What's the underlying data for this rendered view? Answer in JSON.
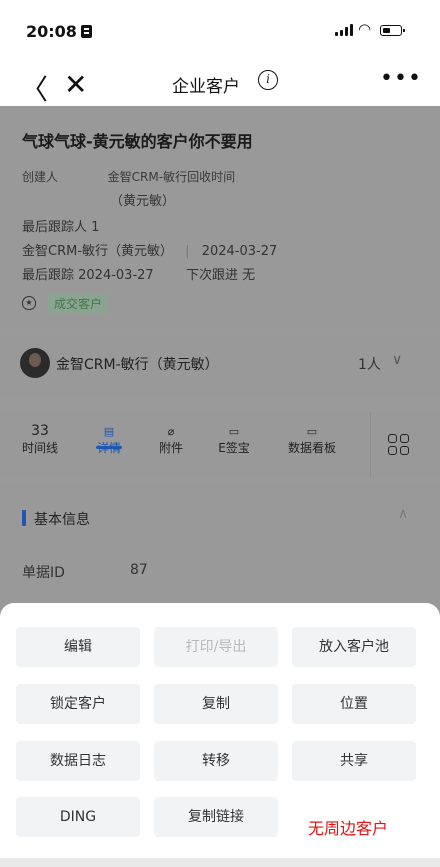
{
  "status_bar": {
    "time": "20:08"
  },
  "nav": {
    "back": "〈",
    "close": "✕",
    "title": "企业客户",
    "info": "i",
    "more": "•••"
  },
  "record": {
    "title": "气球气球-黄元敏的客户你不要用",
    "creator_label": "创建人",
    "creator_value_1": "金智CRM-敏行",
    "recycle_label": "回收时间",
    "creator_value_2": "（黄元敏）",
    "last_follower": "最后跟踪人  1",
    "person_line": "金智CRM-敏行（黄元敏）",
    "divider": "|",
    "date": "2024-03-27",
    "last_follow": "最后跟踪 2024-03-27",
    "next_follow": "下次跟进 无",
    "status_tag": "成交客户"
  },
  "owner": {
    "name": "金智CRM-敏行（黄元敏）",
    "count": "1人"
  },
  "tabs": [
    {
      "count": "33",
      "label": "时间线"
    },
    {
      "icon": "▤",
      "label": "详情"
    },
    {
      "icon": "⌀",
      "label": "附件"
    },
    {
      "icon": "▭",
      "label": "E签宝"
    },
    {
      "icon": "▭",
      "label": "数据看板"
    }
  ],
  "section": {
    "title": "基本信息",
    "field_label": "单据ID",
    "field_value": "87"
  },
  "actions": [
    [
      "编辑",
      "打印/导出",
      "放入客户池"
    ],
    [
      "锁定客户",
      "复制",
      "位置"
    ],
    [
      "数据日志",
      "转移",
      "共享"
    ],
    [
      "DING",
      "复制链接"
    ]
  ],
  "overlay_text": "无周边客户",
  "colors": {
    "accent": "#1f56b0",
    "alert": "#e01414"
  }
}
